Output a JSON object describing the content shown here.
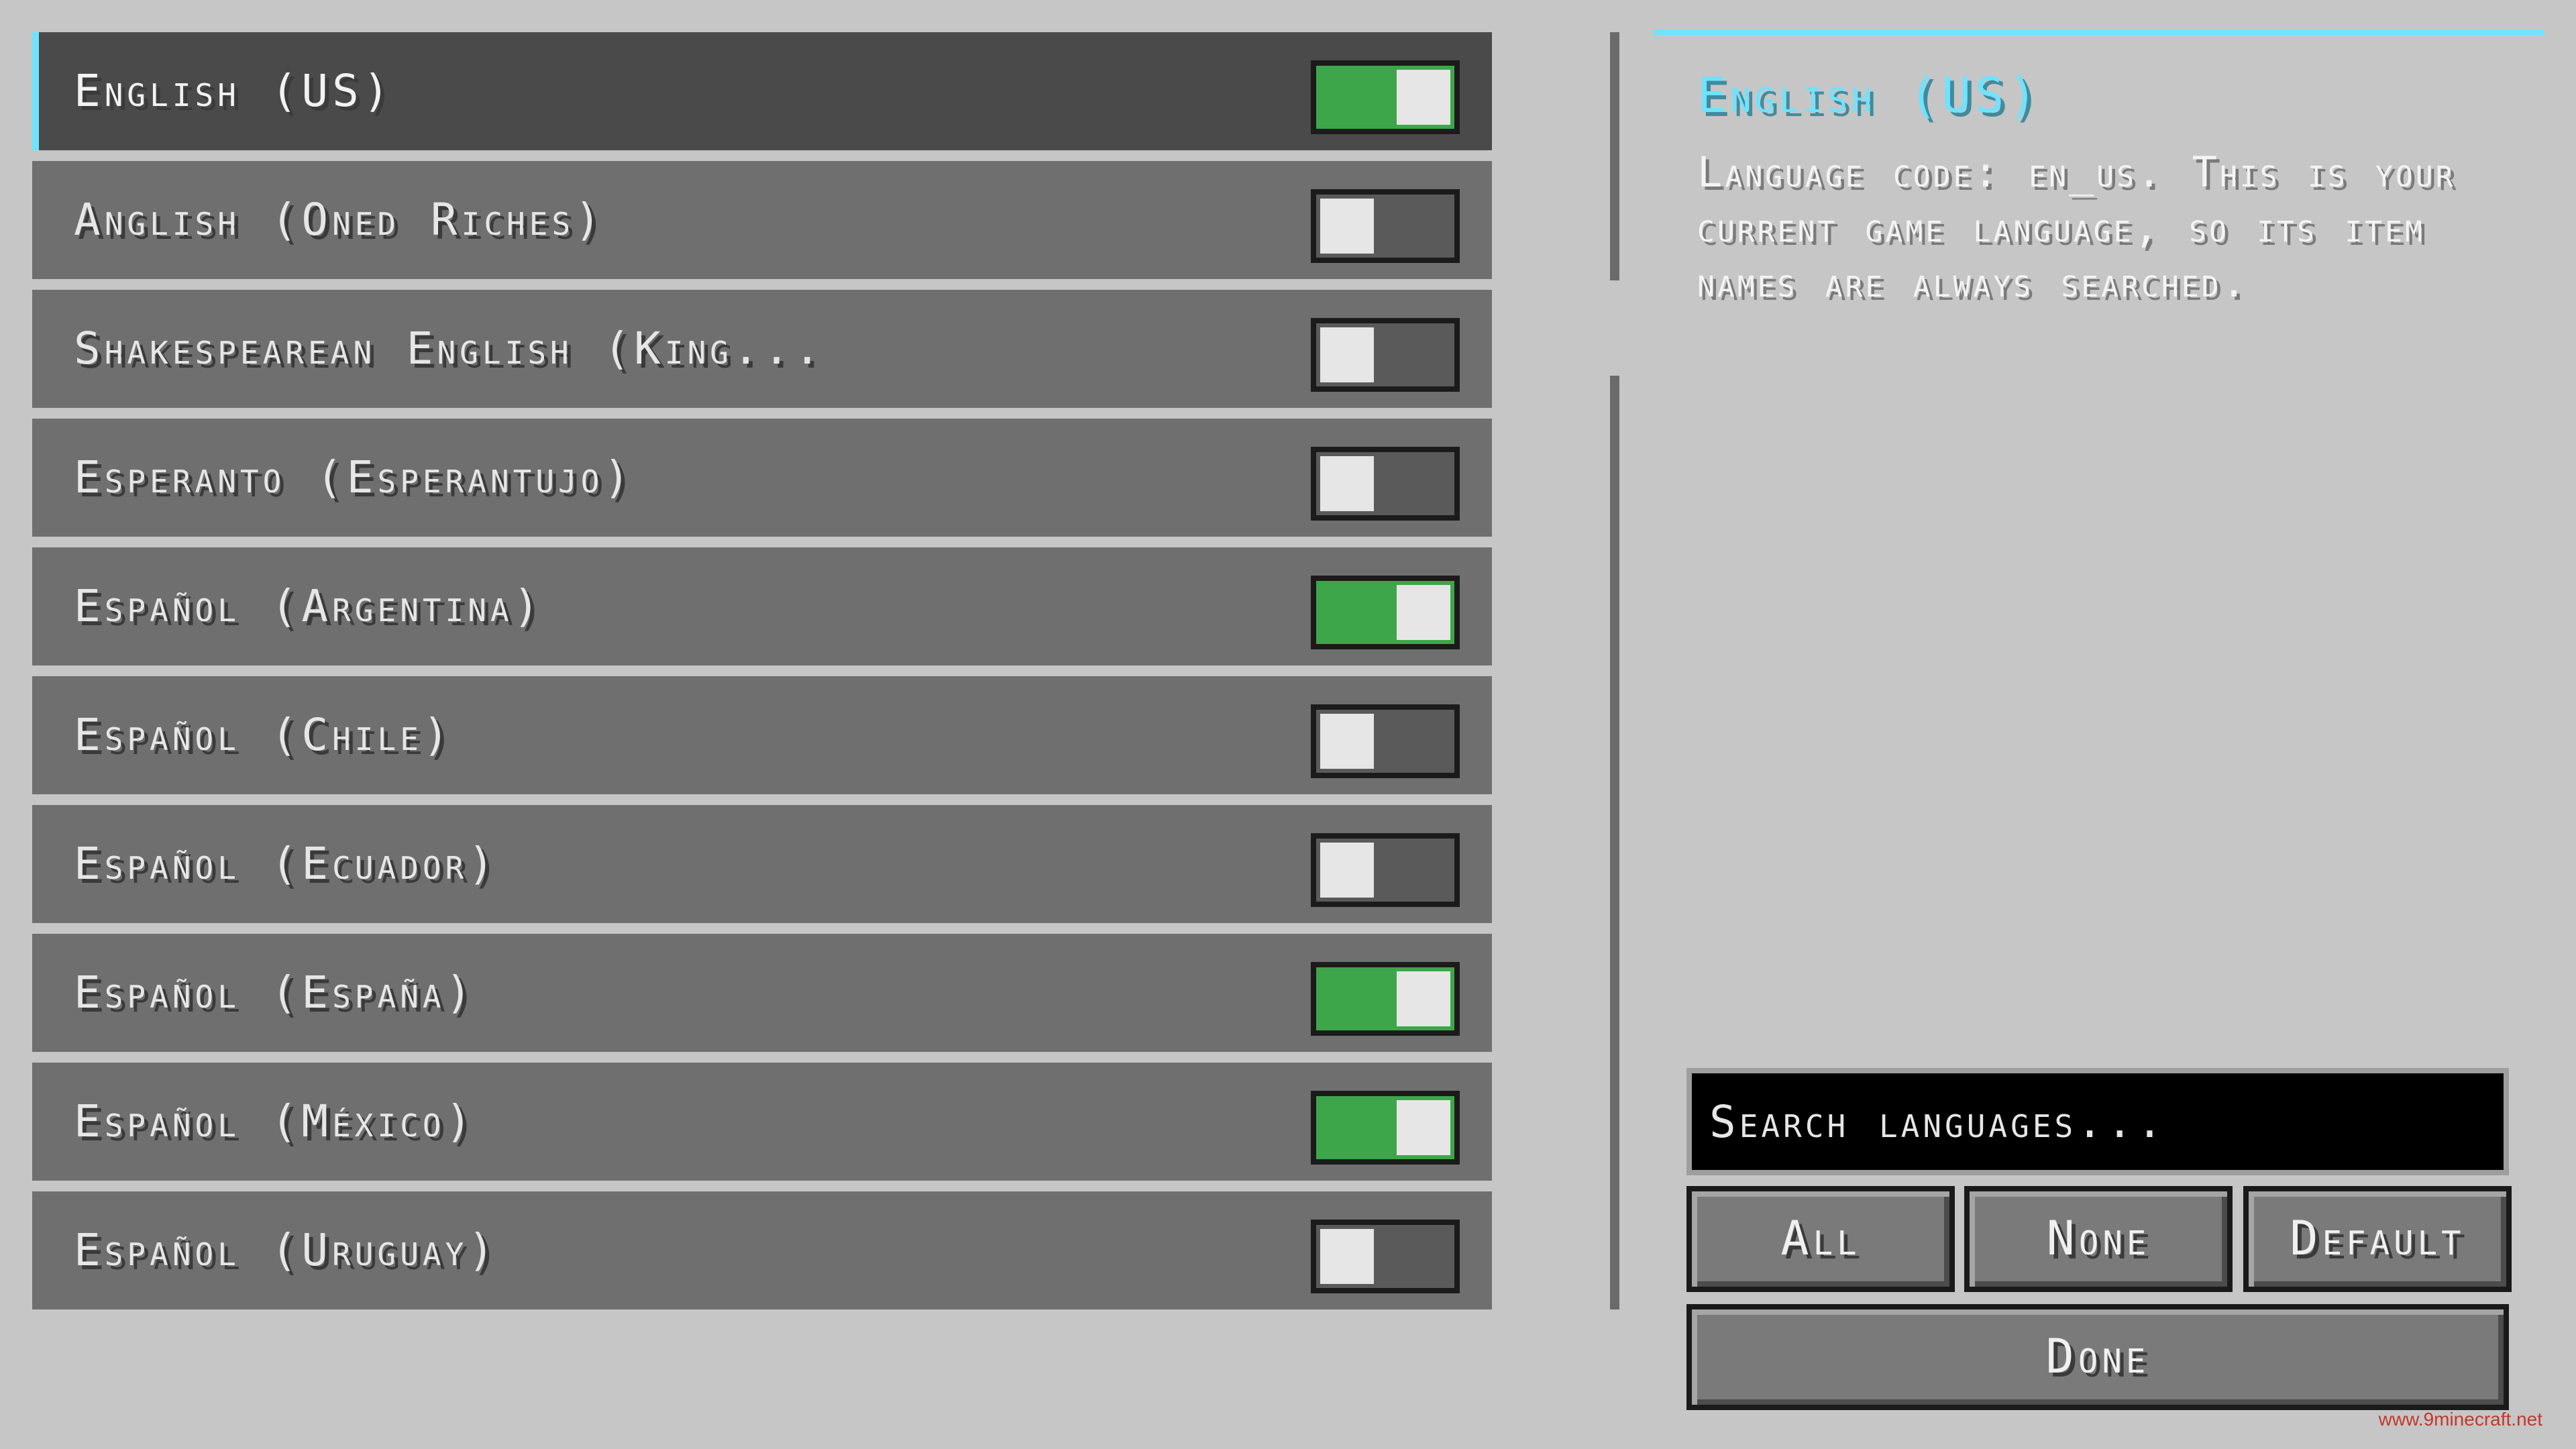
{
  "languages": [
    {
      "label": "English (US)",
      "on": true,
      "selected": true
    },
    {
      "label": "Anglish (Oned Riches)",
      "on": false,
      "selected": false
    },
    {
      "label": "Shakespearean English (King...",
      "on": false,
      "selected": false
    },
    {
      "label": "Esperanto (Esperantujo)",
      "on": false,
      "selected": false
    },
    {
      "label": "Español (Argentina)",
      "on": true,
      "selected": false
    },
    {
      "label": "Español (Chile)",
      "on": false,
      "selected": false
    },
    {
      "label": "Español (Ecuador)",
      "on": false,
      "selected": false
    },
    {
      "label": "Español (España)",
      "on": true,
      "selected": false
    },
    {
      "label": "Español (México)",
      "on": true,
      "selected": false
    },
    {
      "label": "Español (Uruguay)",
      "on": false,
      "selected": false
    }
  ],
  "details": {
    "title": "English (US)",
    "description": "Language code: en_us. This is your current game language, so its item names are always searched."
  },
  "search": {
    "placeholder": "Search languages..."
  },
  "buttons": {
    "all": "All",
    "none": "None",
    "default": "Default",
    "done": "Done"
  },
  "watermark": "www.9minecraft.net",
  "colors": {
    "background": "#c6c6c6",
    "row": "#6f6f6f",
    "row_selected": "#4a4a4a",
    "accent": "#6fe3ff",
    "toggle_on": "#3ea64a",
    "toggle_off": "#5a5a5a"
  }
}
